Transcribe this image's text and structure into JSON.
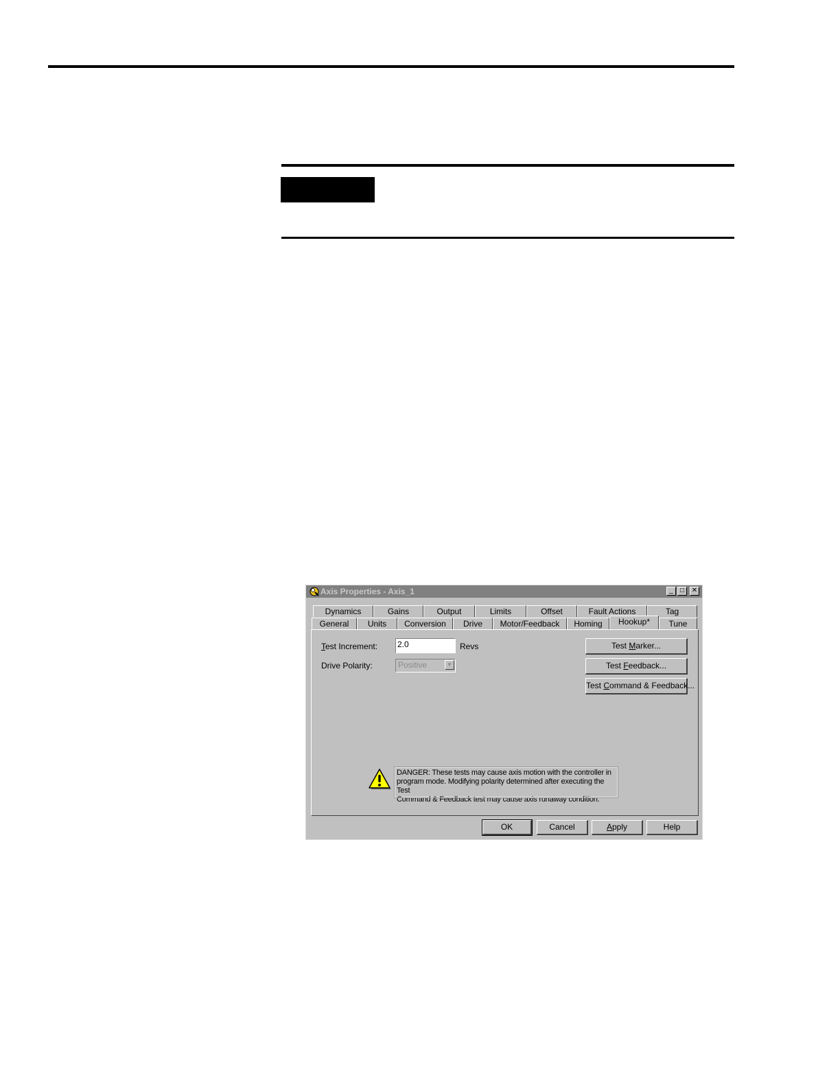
{
  "dialog": {
    "title": "Axis Properties - Axis_1",
    "window_buttons": {
      "minimize": "_",
      "maximize": "□",
      "close": "✕"
    },
    "tabs_back_row": [
      "Dynamics",
      "Gains",
      "Output",
      "Limits",
      "Offset",
      "Fault Actions",
      "Tag"
    ],
    "tabs_front_row": [
      "General",
      "Units",
      "Conversion",
      "Drive",
      "Motor/Feedback",
      "Homing",
      "Hookup*",
      "Tune"
    ],
    "active_tab": "Hookup*",
    "hookup": {
      "test_increment_label": "Test Increment:",
      "test_increment_value": "2.0",
      "test_increment_unit": "Revs",
      "drive_polarity_label": "Drive Polarity:",
      "drive_polarity_value": "Positive",
      "buttons": {
        "test_marker": "Test Marker...",
        "test_feedback": "Test Feedback...",
        "test_command_feedback": "Test Command & Feedback..."
      },
      "warning_lines": [
        "DANGER: These tests may cause axis motion with the controller in",
        "program mode. Modifying polarity determined after executing the Test",
        "Command & Feedback test may cause axis runaway condition."
      ]
    },
    "footer_buttons": {
      "ok": "OK",
      "cancel": "Cancel",
      "apply": "Apply",
      "help": "Help"
    },
    "colors": {
      "face": "#c0c0c0",
      "titlebar_inactive": "#808080",
      "warning_yellow": "#ffff00"
    },
    "icons": {
      "title": "axis-properties-icon",
      "warning": "warning-triangle-icon"
    }
  }
}
